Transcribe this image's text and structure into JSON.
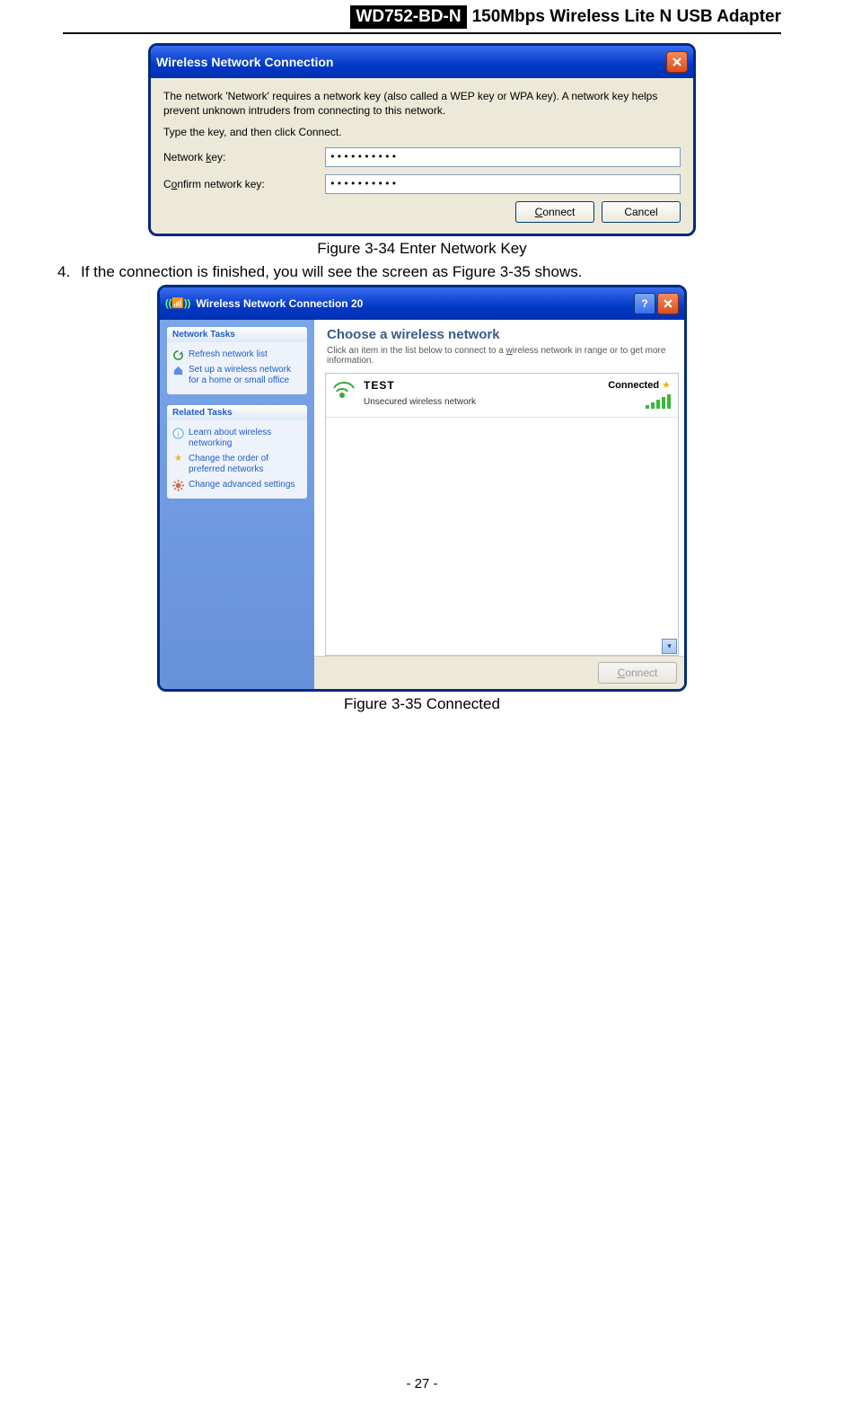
{
  "header": {
    "code": "WD752-BD-N",
    "desc": "150Mbps Wireless Lite N USB Adapter"
  },
  "dialog1": {
    "title": "Wireless Network Connection",
    "body1": "The network 'Network' requires a network key (also called a WEP key or WPA key). A network key helps prevent unknown intruders from connecting to this network.",
    "body2": "Type the key, and then click Connect.",
    "label1": "Network key:",
    "label2": "Confirm network key:",
    "value1": "••••••••••",
    "value2": "••••••••••",
    "btnConnect": "Connect",
    "btnCancel": "Cancel"
  },
  "caption1": "Figure 3-34 Enter Network Key",
  "step4": {
    "num": "4.",
    "text": "If the connection is finished, you will see the screen as Figure 3-35 shows."
  },
  "dialog2": {
    "title": "Wireless Network Connection 20",
    "side": {
      "tasksHead": "Network Tasks",
      "task1": "Refresh network list",
      "task2": "Set up a wireless network for a home or small office",
      "relatedHead": "Related Tasks",
      "rel1": "Learn about wireless networking",
      "rel2": "Change the order of preferred networks",
      "rel3": "Change advanced settings"
    },
    "content": {
      "heading": "Choose a wireless network",
      "sub": "Click an item in the list below to connect to a wireless network in range or to get more information.",
      "net": {
        "name": "TEST",
        "desc": "Unsecured wireless network",
        "status": "Connected"
      },
      "btnConnect": "Connect"
    }
  },
  "caption2": "Figure 3-35 Connected",
  "pageNum": "- 27 -"
}
